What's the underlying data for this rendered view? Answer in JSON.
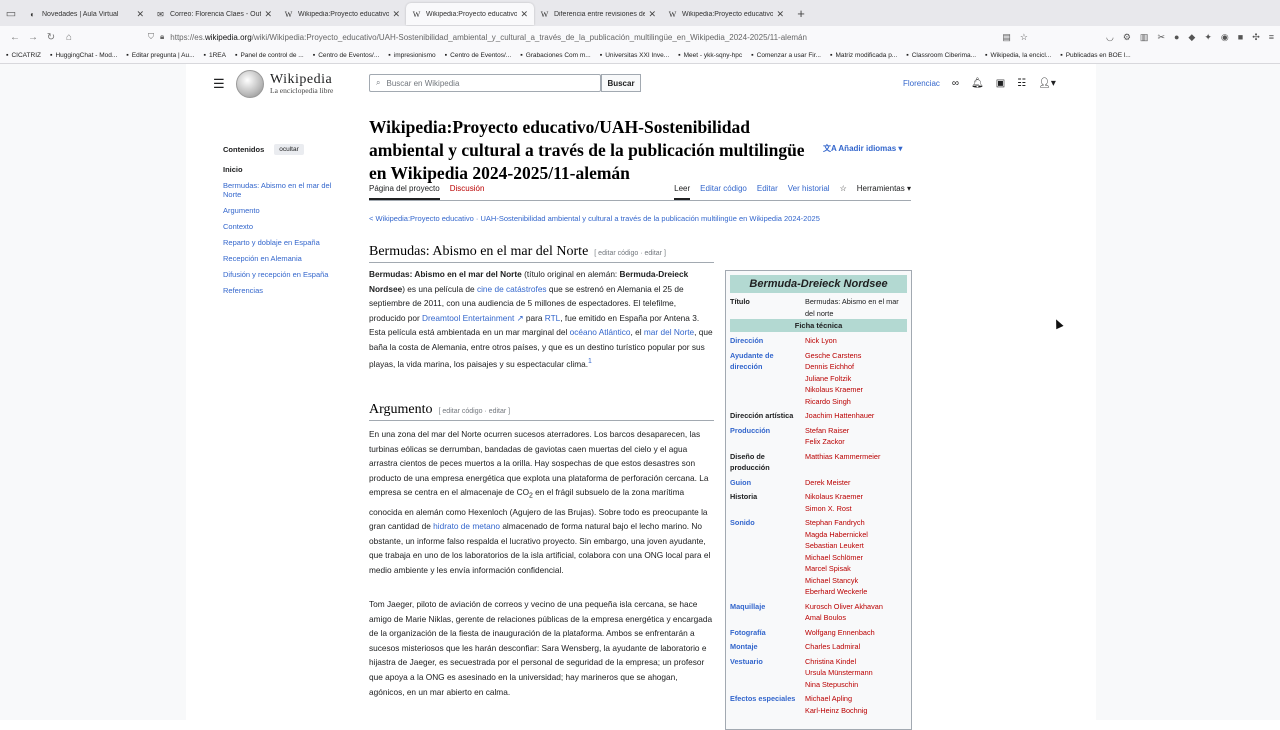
{
  "browser": {
    "tabs": [
      {
        "label": "Novedades | Aula Virtual",
        "icon": "moodle-icon"
      },
      {
        "label": "Correo: Florencia Claes - Outlook",
        "icon": "outlook-icon"
      },
      {
        "label": "Wikipedia:Proyecto educativo/UAH",
        "icon": "wikipedia-icon"
      },
      {
        "label": "Wikipedia:Proyecto educativo/UAH",
        "icon": "wikipedia-icon",
        "active": true
      },
      {
        "label": "Diferencia entre revisiones de «Wikipedia",
        "icon": "wikipedia-icon"
      },
      {
        "label": "Wikipedia:Proyecto educativo/UAH",
        "icon": "wikipedia-icon"
      }
    ],
    "url_prefix": "https://es.",
    "url_domain": "wikipedia.org",
    "url_rest": "/wiki/Wikipedia:Proyecto_educativo/UAH-Sostenibilidad_ambiental_y_cultural_a_través_de_la_publicación_multilingüe_en_Wikipedia_2024-2025/11-alemán",
    "bookmarks": [
      "CICATRIZ",
      "HuggingChat - Mod...",
      "Editar pregunta | Au...",
      "1REA",
      "Panel de control de ...",
      "Centro de Eventos/...",
      "impresionismo",
      "Centro de Eventos/...",
      "Grabaciones Com m...",
      "Universitas XXI Inve...",
      "Meet - ykk-sqny-hpc",
      "Comenzar a usar Fir...",
      "Matriz modificada p...",
      "Classroom Ciberima...",
      "Wikipedia, la encicl...",
      "Publicadas en BOE l..."
    ]
  },
  "wiki": {
    "wordmark": "Wikipedia",
    "tagline": "La enciclopedia libre",
    "search_placeholder": "Buscar en Wikipedia",
    "search_button": "Buscar",
    "username": "Florenciac",
    "toc_title": "Contenidos",
    "toc_hide": "ocultar",
    "toc": [
      "Inicio",
      "Bermudas: Abismo en el mar del Norte",
      "Argumento",
      "Contexto",
      "Reparto y doblaje en España",
      "Recepción en Alemania",
      "Difusión y recepción en España",
      "Referencias"
    ],
    "title": "Wikipedia:Proyecto educativo/UAH-Sostenibilidad ambiental y cultural a través de la publicación multilingüe en Wikipedia 2024-2025/11-alemán",
    "add_languages": "Añadir idiomas",
    "tab_project": "Página del proyecto",
    "tab_discussion": "Discusión",
    "tab_read": "Leer",
    "tab_edit_code": "Editar código",
    "tab_edit": "Editar",
    "tab_history": "Ver historial",
    "tab_tools": "Herramientas",
    "breadcrumb": "< Wikipedia:Proyecto educativo · UAH-Sostenibilidad ambiental y cultural a través de la publicación multilingüe en Wikipedia 2024-2025",
    "section1": "Bermudas: Abismo en el mar del Norte",
    "section2": "Argumento",
    "edit_links": "[ editar código · editar ]",
    "p1_a": "Bermudas: Abismo en el mar del Norte",
    "p1_b": " (título original en alemán: ",
    "p1_c": "Bermuda-Dreieck Nordsee",
    "p1_d": ") es una película de ",
    "p1_link1": "cine de catástrofes",
    "p1_e": " que se estrenó en Alemania el 25 de septiembre de 2011, con una audiencia de 5 millones de espectadores. El telefilme, producido por ",
    "p1_link2": "Dreamtool Entertainment",
    "p1_f": " para ",
    "p1_link3": "RTL",
    "p1_g": ", fue emitido en España por Antena 3. Esta película está ambientada en un mar marginal del ",
    "p1_link4": "océano Atlántico",
    "p1_h": ", el ",
    "p1_link5": "mar del Norte",
    "p1_i": ", que baña la costa de Alemania, entre otros países, y que es un destino turístico popular por sus playas, la vida marina, los paisajes y su espectacular clima.",
    "p1_ref": "1",
    "p2_a": "En una zona del mar del Norte ocurren sucesos aterradores. Los barcos desaparecen, las turbinas eólicas se derrumban, bandadas de gaviotas caen muertas del cielo y el agua arrastra cientos de peces muertos a la orilla. Hay sospechas de que estos desastres son producto de una empresa energética que explota una plataforma de perforación cercana. La empresa se centra en el almacenaje de CO",
    "p2_sub": "2",
    "p2_b": " en el frágil subsuelo de la zona marítima conocida en alemán como Hexenloch (Agujero de las Brujas). Sobre todo es preocupante la gran cantidad de ",
    "p2_link": "hidrato de metano",
    "p2_c": " almacenado de forma natural bajo el lecho marino. No obstante, un informe falso respalda el lucrativo proyecto. Sin embargo, una joven ayudante, que trabaja en uno de los laboratorios de la isla artificial, colabora con una ONG local para el medio ambiente y les envía información confidencial.",
    "p3": "Tom Jaeger, piloto de aviación de correos y vecino de una pequeña isla cercana, se hace amigo de Marie Niklas, gerente de relaciones públicas de la empresa energética y encargada de la organización de la fiesta de inauguración de la plataforma. Ambos se enfrentarán a sucesos misteriosos que les harán desconfiar: Sara Wensberg, la ayudante de laboratorio e hijastra de Jaeger, es secuestrada por el personal de seguridad de la empresa; un profesor que apoya a la ONG es asesinado en la universidad; hay marineros que se ahogan, agónicos, en un mar abierto en calma.",
    "infobox": {
      "title": "Bermuda-Dreieck Nordsee",
      "titulo_k": "Título",
      "titulo_v": "Bermudas: Abismo en el mar del norte",
      "ficha": "Ficha técnica",
      "rows": [
        {
          "k": "Dirección",
          "v": "Nick Lyon",
          "link": true
        },
        {
          "k": "Ayudante de dirección",
          "v": "Gesche Carstens\nDennis Eichhof\nJuliane Foltzik\nNikolaus Kraemer\nRicardo Singh",
          "link": true
        },
        {
          "k": "Dirección artística",
          "v": "Joachim Hattenhauer",
          "link": false
        },
        {
          "k": "Producción",
          "v": "Stefan Raiser\nFelix Zackor",
          "link": true
        },
        {
          "k": "Diseño de producción",
          "v": "Matthias Kammermeier",
          "link": false
        },
        {
          "k": "Guion",
          "v": "Derek Meister",
          "link": true
        },
        {
          "k": "Historia",
          "v": "Nikolaus Kraemer\nSimon X. Rost",
          "link": false
        },
        {
          "k": "Sonido",
          "v": "Stephan Fandrych\nMagda Habernickel\nSebastian Leukert\nMichael Schlömer\nMarcel Spisak\nMichael Stancyk\nEberhard Weckerle",
          "link": true
        },
        {
          "k": "Maquillaje",
          "v": "Kurosch Oliver Akhavan\nAmal Boulos",
          "link": true
        },
        {
          "k": "Fotografía",
          "v": "Wolfgang Ennenbach",
          "link": true
        },
        {
          "k": "Montaje",
          "v": "Charles Ladmiral",
          "link": true
        },
        {
          "k": "Vestuario",
          "v": "Christina Kindel\nUrsula Münstermann\nNina Stepuschin",
          "link": true
        },
        {
          "k": "Efectos especiales",
          "v": "Michael Apling\nKarl-Heinz Bochnig",
          "link": true
        }
      ]
    }
  }
}
